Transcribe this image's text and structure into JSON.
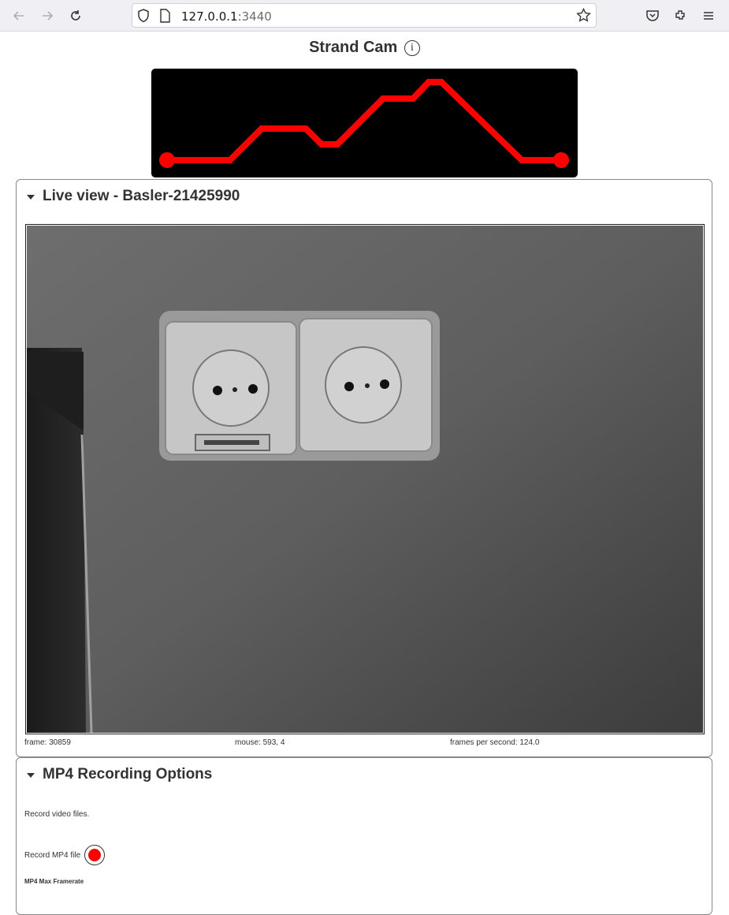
{
  "browser": {
    "url_host": "127.0.0.1",
    "url_port": ":3440"
  },
  "page": {
    "title": "Strand Cam",
    "info_glyph": "i"
  },
  "live_view": {
    "title": "Live view - Basler-21425990",
    "frame_text": "frame: 30859",
    "mouse_text": "mouse: 593, 4",
    "fps_text": "frames per second: 124.0"
  },
  "mp4": {
    "title": "MP4 Recording Options",
    "description": "Record video files.",
    "record_label": "Record MP4 file",
    "max_framerate_label": "MP4 Max Framerate"
  },
  "colors": {
    "logo_line": "#ff0000",
    "record_dot": "#ff0000"
  }
}
